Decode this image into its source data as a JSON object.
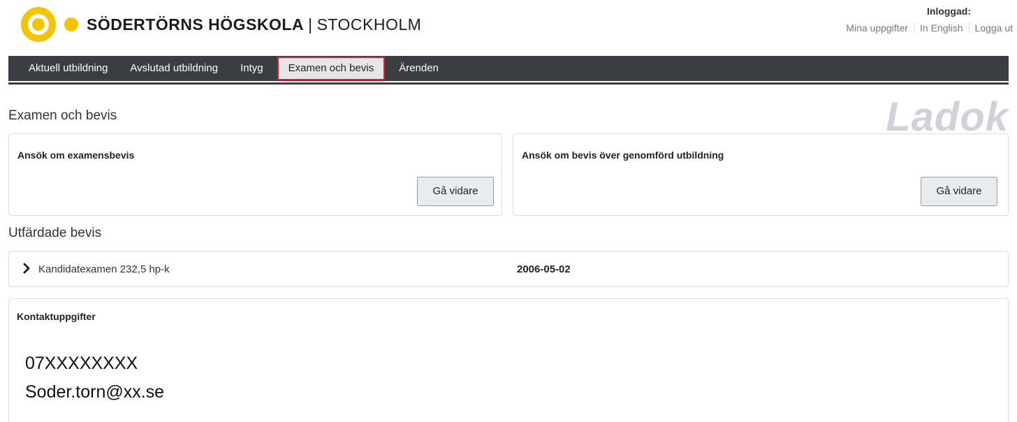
{
  "header": {
    "logo_bold": "SÖDERTÖRNS HÖGSKOLA",
    "logo_sep": "|",
    "logo_light": "STOCKHOLM",
    "logged_in_label": "Inloggad:",
    "links": [
      "Mina uppgifter",
      "In English",
      "Logga ut"
    ]
  },
  "nav": {
    "items": [
      "Aktuell utbildning",
      "Avslutad utbildning",
      "Intyg",
      "Examen och bevis",
      "Ärenden"
    ],
    "active_index": 3
  },
  "watermark": "Ladok",
  "page_title": "Examen och bevis",
  "cards": [
    {
      "title": "Ansök om examensbevis",
      "button": "Gå vidare"
    },
    {
      "title": "Ansök om bevis över genomförd utbildning",
      "button": "Gå vidare"
    }
  ],
  "issued": {
    "title": "Utfärdade bevis",
    "rows": [
      {
        "name": "Kandidatexamen 232,5 hp-k",
        "date": "2006-05-02"
      }
    ]
  },
  "contact": {
    "title": "Kontaktuppgifter",
    "phone": "07XXXXXXXX",
    "email": "Soder.torn@xx.se"
  },
  "colors": {
    "logo_yellow": "#f5c400",
    "nav_bg": "#3a3d42",
    "active_border": "#d0223b",
    "watermark": "#cfd3d9"
  }
}
